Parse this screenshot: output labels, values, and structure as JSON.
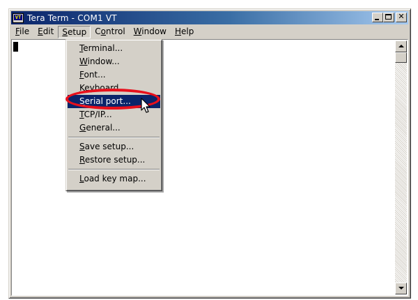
{
  "window": {
    "icon_text": "VT",
    "title": "Tera Term - COM1 VT"
  },
  "menubar": {
    "items": [
      {
        "acc": "F",
        "rest": "ile"
      },
      {
        "acc": "E",
        "rest": "dit"
      },
      {
        "acc": "S",
        "rest": "etup"
      },
      {
        "pre": "C",
        "acc": "o",
        "rest": "ntrol"
      },
      {
        "acc": "W",
        "rest": "indow"
      },
      {
        "acc": "H",
        "rest": "elp"
      }
    ]
  },
  "setup_menu": {
    "items": [
      {
        "acc": "T",
        "rest": "erminal..."
      },
      {
        "acc": "W",
        "rest": "indow..."
      },
      {
        "acc": "F",
        "rest": "ont..."
      },
      {
        "acc": "K",
        "rest": "eyboard..."
      },
      {
        "acc": "S",
        "rest": "erial port..."
      },
      {
        "acc": "T",
        "rest": "CP/IP..."
      },
      {
        "acc": "G",
        "rest": "eneral..."
      },
      {
        "acc": "S",
        "rest": "ave setup..."
      },
      {
        "acc": "R",
        "rest": "estore setup..."
      },
      {
        "acc": "L",
        "rest": "oad key map..."
      }
    ],
    "highlighted": "Serial port..."
  },
  "annotation": {
    "ring_color": "#e8101c"
  },
  "colors": {
    "title_gradient_start": "#0a246a",
    "title_gradient_end": "#a6caf0",
    "menu_highlight": "#0a246a",
    "face": "#d4d0c8"
  },
  "icons": [
    "app-icon",
    "minimize-icon",
    "maximize-icon",
    "close-icon",
    "scroll-up-arrow-icon",
    "scroll-down-arrow-icon",
    "mouse-pointer-icon"
  ]
}
